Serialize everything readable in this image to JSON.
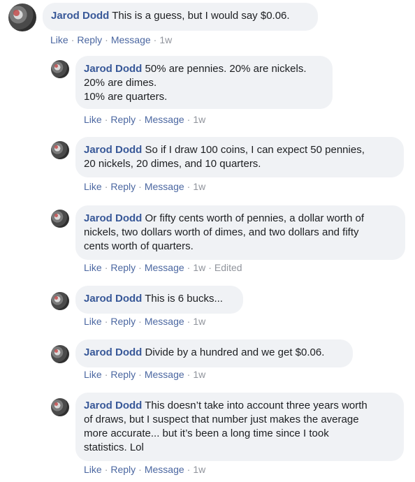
{
  "comments": [
    {
      "author": "Jarod Dodd",
      "text": "This is a guess, but I would say $0.06.",
      "time": "1w",
      "edited": ""
    },
    {
      "author": "Jarod Dodd",
      "text": "50% are pennies. 20% are nickels.\n20% are dimes.\n10% are quarters.",
      "time": "1w",
      "edited": ""
    },
    {
      "author": "Jarod Dodd",
      "text": "So if I draw 100 coins, I can expect 50 pennies,\n20 nickels, 20 dimes, and 10 quarters.",
      "time": "1w",
      "edited": ""
    },
    {
      "author": "Jarod Dodd",
      "text": "Or fifty cents worth of pennies, a dollar worth of\nnickels, two dollars worth of dimes, and two dollars and fifty\ncents worth of quarters.",
      "time": "1w",
      "edited": "Edited"
    },
    {
      "author": "Jarod Dodd",
      "text": "This is 6 bucks...",
      "time": "1w",
      "edited": ""
    },
    {
      "author": "Jarod Dodd",
      "text": "Divide by a hundred and we get $0.06.",
      "time": "1w",
      "edited": ""
    },
    {
      "author": "Jarod Dodd",
      "text": "This doesn’t take into account three years worth\nof draws, but I suspect that number just makes the average\nmore accurate... but it’s been a long time since I took\nstatistics. Lol",
      "time": "1w",
      "edited": ""
    }
  ],
  "actions": {
    "like": "Like",
    "reply": "Reply",
    "message": "Message",
    "dot": "·"
  }
}
